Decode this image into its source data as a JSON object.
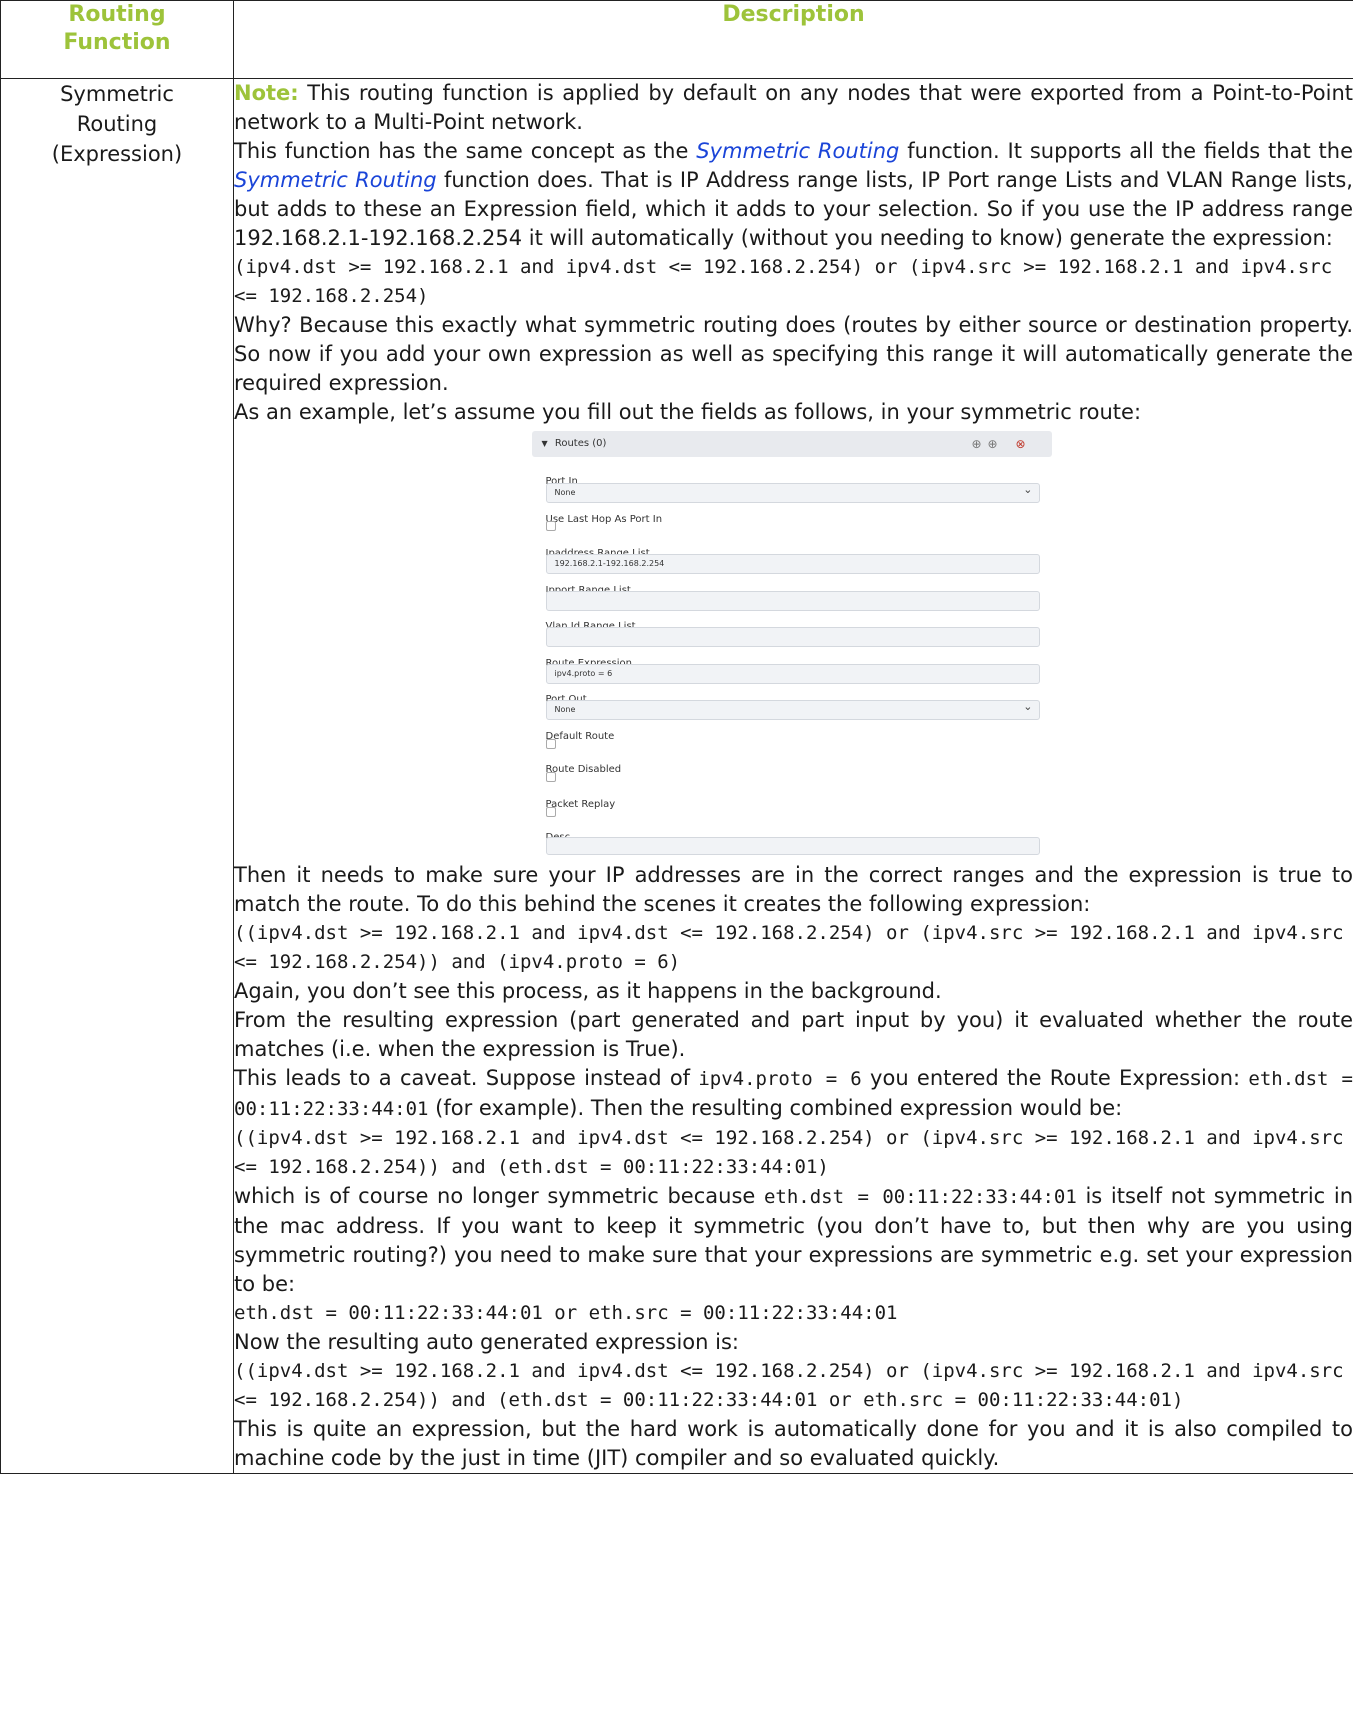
{
  "header": {
    "col1": "Routing\nFunction",
    "col2": "Description"
  },
  "row": {
    "function_name": "Symmetric\nRouting\n(Expression)",
    "note_label": "Note:",
    "note_text": " This routing function is applied by default on any nodes that were exported from a Point-to-Point network to a Multi-Point network.",
    "p1_a": "This function has the same concept as the ",
    "link1": "Symmetric Routing",
    "p1_b": " function. It supports all the fields that the ",
    "link2": "Symmetric Routing",
    "p1_c": " function does. That is IP Address range lists, IP Port range Lists and VLAN Range lists, but adds to these an Expression field, which it adds to your selection. So if you use the IP address range 192.168.2.1-192.168.2.254 it will automatically (without you needing to know) generate the expression:",
    "code1": "(ipv4.dst >= 192.168.2.1 and ipv4.dst <= 192.168.2.254) or (ipv4.src >= 192.168.2.1 and ipv4.src <= 192.168.2.254)",
    "p2": "Why? Because this exactly what symmetric routing does (routes by either source or destination property. So now if you add your own expression as well as specifying this range it will automatically generate the required expression.",
    "p3": "As an example, let’s assume you fill out the fields as follows, in your symmetric route:",
    "p4": "Then it needs to make sure your IP addresses are in the correct ranges and the expression is true to match the route. To do this behind the scenes it creates the following expression:",
    "code2": "((ipv4.dst >= 192.168.2.1 and ipv4.dst <= 192.168.2.254) or (ipv4.src >= 192.168.2.1 and ipv4.src <= 192.168.2.254)) and (ipv4.proto = 6)",
    "p5": "Again, you don’t see this process, as it happens in the background.",
    "p6": "From the resulting expression (part generated and part input by you) it evaluated whether the route matches (i.e. when the expression is True).",
    "p7_a": "This leads to a caveat. Suppose instead of ",
    "p7_code1": "ipv4.proto = 6",
    "p7_b": " you entered the Route Expression: ",
    "p7_code2": "eth.dst = 00:11:22:33:44:01",
    "p7_c": " (for example). Then the resulting combined expression would be:",
    "code3": "((ipv4.dst >= 192.168.2.1 and ipv4.dst <= 192.168.2.254) or (ipv4.src >= 192.168.2.1 and ipv4.src <= 192.168.2.254)) and (eth.dst = 00:11:22:33:44:01)",
    "p8_a": "which is of course no longer symmetric because ",
    "p8_code": "eth.dst = 00:11:22:33:44:01",
    "p8_b": " is itself not symmetric in the mac address. If you want to keep it symmetric (you don’t have to, but then why are you using symmetric routing?) you need to make sure that your expressions are symmetric e.g. set your expression to be:",
    "code4": "eth.dst = 00:11:22:33:44:01 or eth.src = 00:11:22:33:44:01",
    "p9": "Now the resulting auto generated expression is:",
    "code5": "((ipv4.dst >= 192.168.2.1 and ipv4.dst <= 192.168.2.254) or (ipv4.src >= 192.168.2.1 and ipv4.src <= 192.168.2.254)) and (eth.dst = 00:11:22:33:44:01 or eth.src = 00:11:22:33:44:01)",
    "p10": "This is quite an expression, but the hard work is automatically done for you and it is also compiled to machine code by the just in time (JIT) compiler and so evaluated quickly."
  },
  "form": {
    "panel_title": "Routes (0)",
    "port_in_label": "Port In",
    "port_in_value": "None",
    "use_last_hop_label": "Use Last Hop As Port In",
    "ip_range_label": "Ipaddress Range List",
    "ip_range_value": "192.168.2.1-192.168.2.254",
    "port_range_label": "Ipport Range List",
    "vlan_label": "Vlan Id Range List",
    "route_expr_label": "Route Expression",
    "route_expr_value": "ipv4.proto = 6",
    "port_out_label": "Port Out",
    "port_out_value": "None",
    "default_route_label": "Default Route",
    "route_disabled_label": "Route Disabled",
    "packet_replay_label": "Packet Replay",
    "desc_label": "Desc"
  },
  "colors": {
    "accent": "#9dc33a",
    "link": "#1a44d8"
  }
}
